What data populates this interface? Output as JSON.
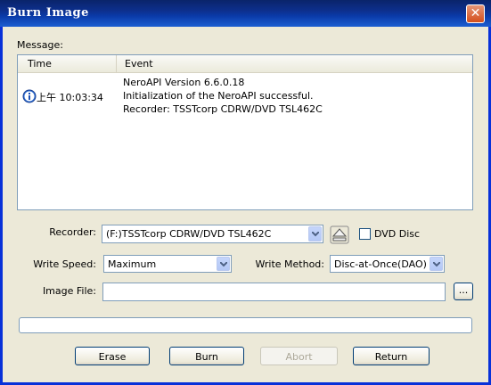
{
  "window": {
    "title": "Burn Image",
    "close_glyph": "✕"
  },
  "message": {
    "label": "Message:",
    "columns": {
      "time": "Time",
      "event": "Event"
    },
    "rows": [
      {
        "time": "",
        "event": "NeroAPI Version 6.6.0.18"
      },
      {
        "time": "上午 10:03:34",
        "event": "Initialization of the NeroAPI successful."
      },
      {
        "time": "",
        "event": "Recorder: TSSTcorp CDRW/DVD TSL462C"
      }
    ],
    "row_icon": "info-icon"
  },
  "recorder": {
    "label": "Recorder:",
    "value": "(F:)TSSTcorp CDRW/DVD TSL462C",
    "eject_icon": "eject-icon"
  },
  "dvd_disc": {
    "label": "DVD Disc",
    "checked": false
  },
  "write_speed": {
    "label": "Write Speed:",
    "value": "Maximum"
  },
  "write_method": {
    "label": "Write Method:",
    "value": "Disc-at-Once(DAO)"
  },
  "image_file": {
    "label": "Image File:",
    "value": "",
    "browse_label": "..."
  },
  "progress": {
    "fraction": 0
  },
  "buttons": {
    "erase": "Erase",
    "burn": "Burn",
    "abort": "Abort",
    "return": "Return"
  }
}
